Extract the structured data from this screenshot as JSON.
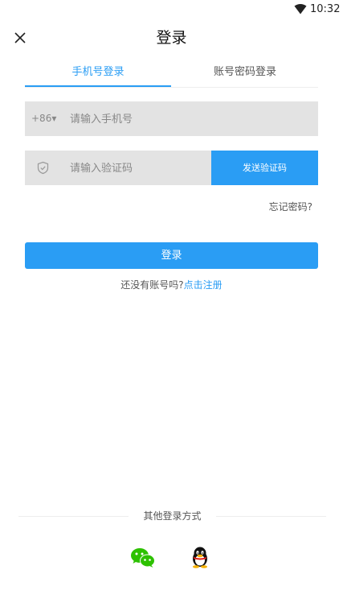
{
  "status_bar": {
    "time": "10:32",
    "wifi_icon": "wifi-icon"
  },
  "header": {
    "title": "登录",
    "close_icon": "close-icon"
  },
  "tabs": [
    {
      "label": "手机号登录",
      "active": true
    },
    {
      "label": "账号密码登录",
      "active": false
    }
  ],
  "phone": {
    "country_code": "+86▾",
    "placeholder": "请输入手机号",
    "value": ""
  },
  "code": {
    "placeholder": "请输入验证码",
    "value": "",
    "icon": "shield-check-icon",
    "send_label": "发送验证码"
  },
  "forgot": {
    "label": "忘记密码?"
  },
  "login": {
    "label": "登录"
  },
  "register": {
    "prompt": "还没有账号吗?",
    "link": "点击注册"
  },
  "other_login": {
    "label": "其他登录方式",
    "providers": [
      {
        "name": "wechat",
        "icon": "wechat-icon"
      },
      {
        "name": "qq",
        "icon": "qq-icon"
      }
    ]
  },
  "colors": {
    "accent": "#2a9df4",
    "input_bg": "#e3e3e3",
    "wechat": "#2dc100"
  }
}
